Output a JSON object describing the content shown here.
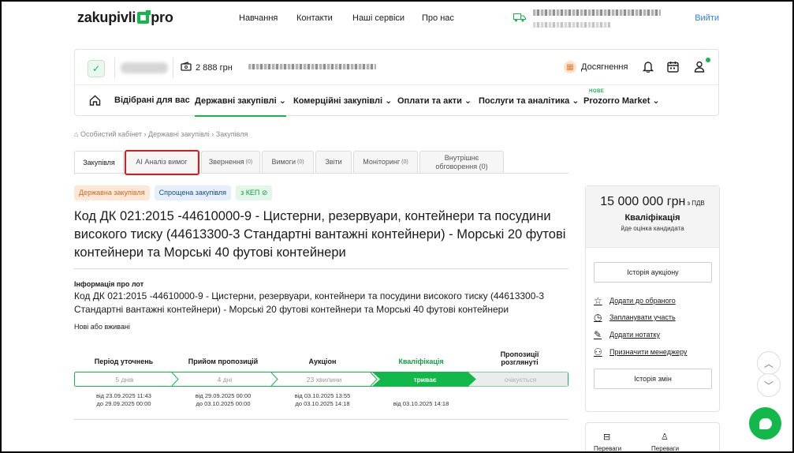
{
  "header": {
    "logo_left": "zakupivli",
    "logo_right": "pro",
    "nav": [
      "Навчання",
      "Контакти",
      "Наші сервіси",
      "Про нас"
    ],
    "login": "Вийти"
  },
  "account": {
    "balance": "2 888 грн",
    "achievements": "Досягнення"
  },
  "subnav": {
    "items": [
      "Відібрані для вас",
      "Державні закупівлі",
      "Комерційні закупівлі",
      "Оплати та акти",
      "Послуги та аналітика",
      "Prozorro Market"
    ],
    "new_badge": "НОВЕ"
  },
  "breadcrumb": "Особистий кабінет › Державні закупівлі › Закупівля",
  "tabs": [
    {
      "label": "Закупівля",
      "count": ""
    },
    {
      "label": "AI Аналіз вимог",
      "count": ""
    },
    {
      "label": "Звернення",
      "count": "(0)"
    },
    {
      "label": "Вимоги",
      "count": "(0)"
    },
    {
      "label": "Звіти",
      "count": ""
    },
    {
      "label": "Моніторинг",
      "count": "(0)"
    },
    {
      "label": "Внутрішнє обговорення (0)",
      "count": ""
    }
  ],
  "chips": [
    "Державна закупівля",
    "Спрощена закупівля",
    "з КЕП"
  ],
  "title": "Код ДК 021:2015 -44610000-9 - Цистерни, резервуари, контейнери та посудини високого тиску (44613300-3 Стандартні вантажні контейнери) - Морські 20 футові контейнери та Морські 40 футові контейнери",
  "lot": {
    "heading": "Інформація про лот",
    "text": "Код ДК 021:2015 -44610000-9 - Цистерни, резервуари, контейнери та посудини високого тиску (44613300-3 Стандартні вантажні контейнери) - Морські 20 футові контейнери та Морські 40 футові контейнери",
    "condition": "Нові або вживані"
  },
  "timeline": {
    "stages": [
      {
        "name": "Період уточнень",
        "duration": "5 днів",
        "from": "від 23.09.2025 11:43",
        "to": "до 29.09.2025 00:00"
      },
      {
        "name": "Прийом пропозицій",
        "duration": "4 дні",
        "from": "від 29.09.2025 00:00",
        "to": "до 03.10.2025 00:00"
      },
      {
        "name": "Аукціон",
        "duration": "23 хвилини",
        "from": "від 03.10.2025 13:55",
        "to": "до 03.10.2025 14:18"
      },
      {
        "name": "Кваліфікація",
        "duration": "триває",
        "from": "від 03.10.2025 14:18",
        "to": ""
      },
      {
        "name": "Пропозиції розглянуті",
        "duration": "очікується",
        "from": "",
        "to": ""
      }
    ],
    "colors": {
      "active": "#12b84a",
      "pending": "#ececec",
      "done_border": "#12b84a"
    }
  },
  "summary": {
    "amount": "15 000 000 грн",
    "vat": "з ПДВ",
    "status": "Кваліфікація",
    "status_sub": "йде оцінка кандидата",
    "auction_history": "Історія аукціону",
    "actions": [
      "Додати до обраного",
      "Запланувати участь",
      "Додати нотатку",
      "Призначити менеджеру"
    ],
    "change_history": "Історія змін",
    "bottom": [
      "Переваги",
      "Переваги"
    ]
  }
}
